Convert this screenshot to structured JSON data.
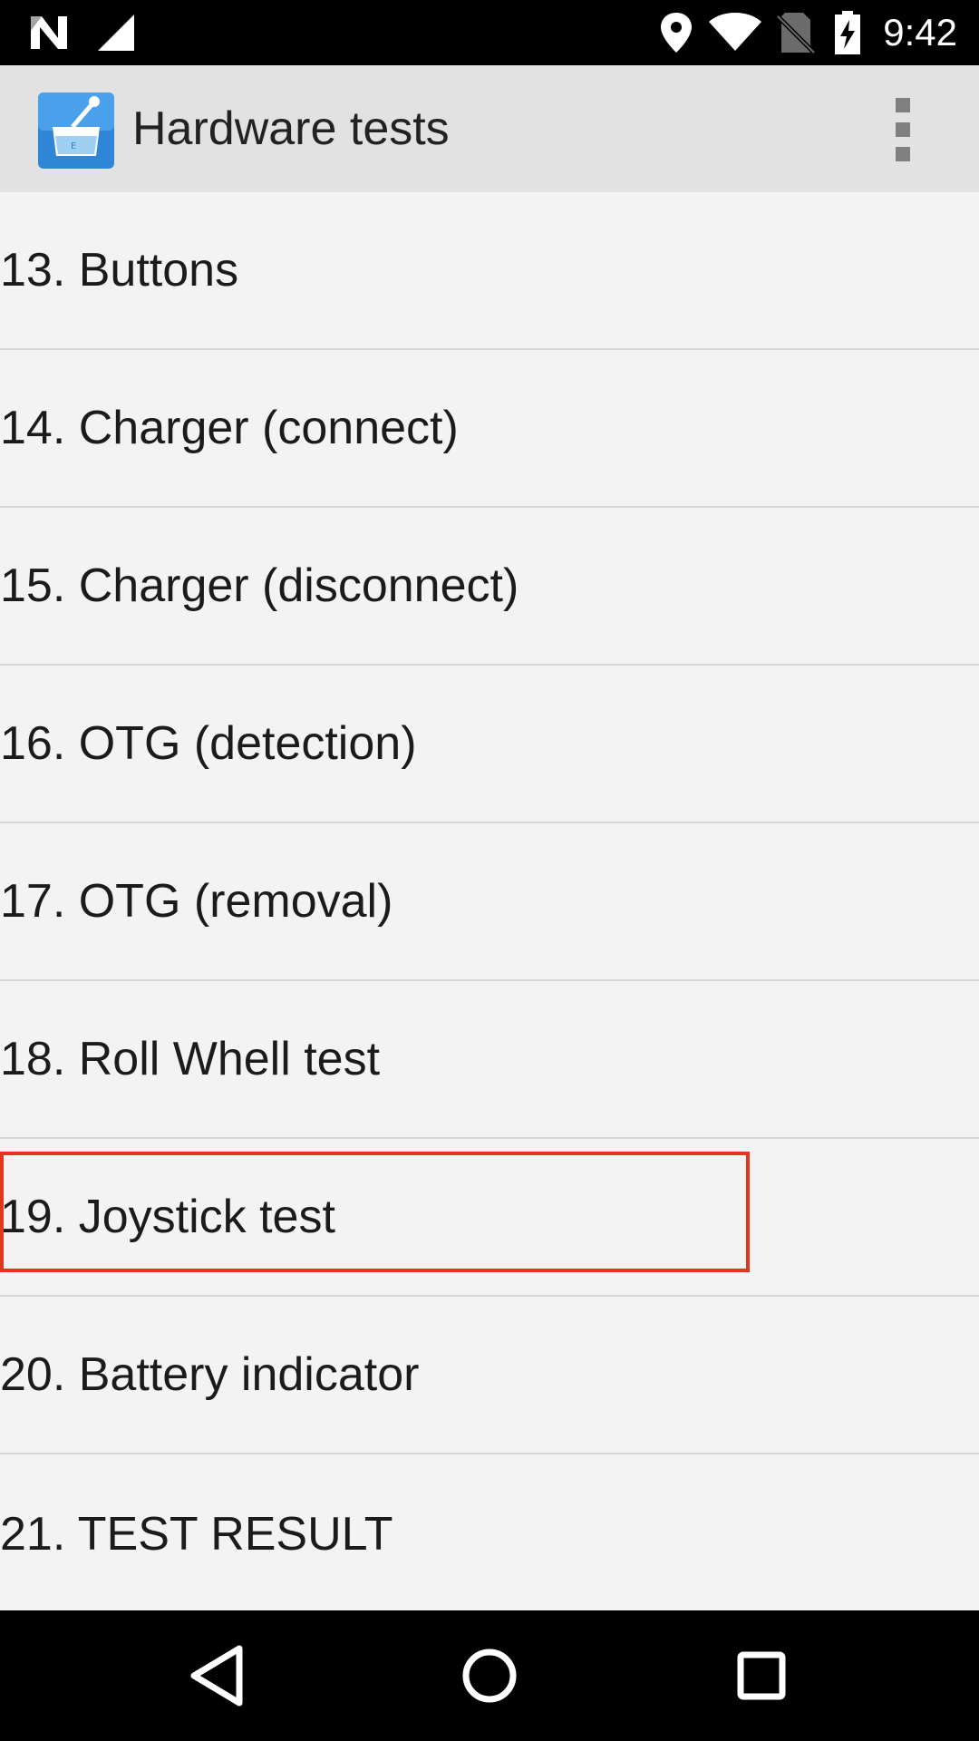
{
  "status_bar": {
    "time": "9:42",
    "icons": [
      "n-logo-icon",
      "signal-icon",
      "location-icon",
      "wifi-icon",
      "no-sim-icon",
      "battery-charging-icon"
    ]
  },
  "app_bar": {
    "title": "Hardware tests",
    "icon": "hardware-tests-app-icon",
    "menu_icon": "overflow-menu-icon"
  },
  "tests": [
    {
      "label": "13. Buttons"
    },
    {
      "label": "14. Charger (connect)"
    },
    {
      "label": "15. Charger (disconnect)"
    },
    {
      "label": "16. OTG (detection)"
    },
    {
      "label": "17. OTG (removal)"
    },
    {
      "label": "18. Roll Whell test"
    },
    {
      "label": "19. Joystick test"
    },
    {
      "label": "20. Battery indicator"
    },
    {
      "label": "21. TEST RESULT"
    }
  ],
  "highlighted_item": "19. Joystick test",
  "colors": {
    "status_bar": "#000000",
    "app_bar": "#e2e2e2",
    "list_background": "#f3f3f3",
    "divider": "#d6d6d6",
    "highlight": "#e2361f",
    "app_icon_blue": "#2f86d6"
  },
  "nav_bar": {
    "buttons": [
      "back-icon",
      "home-icon",
      "recents-icon"
    ]
  }
}
